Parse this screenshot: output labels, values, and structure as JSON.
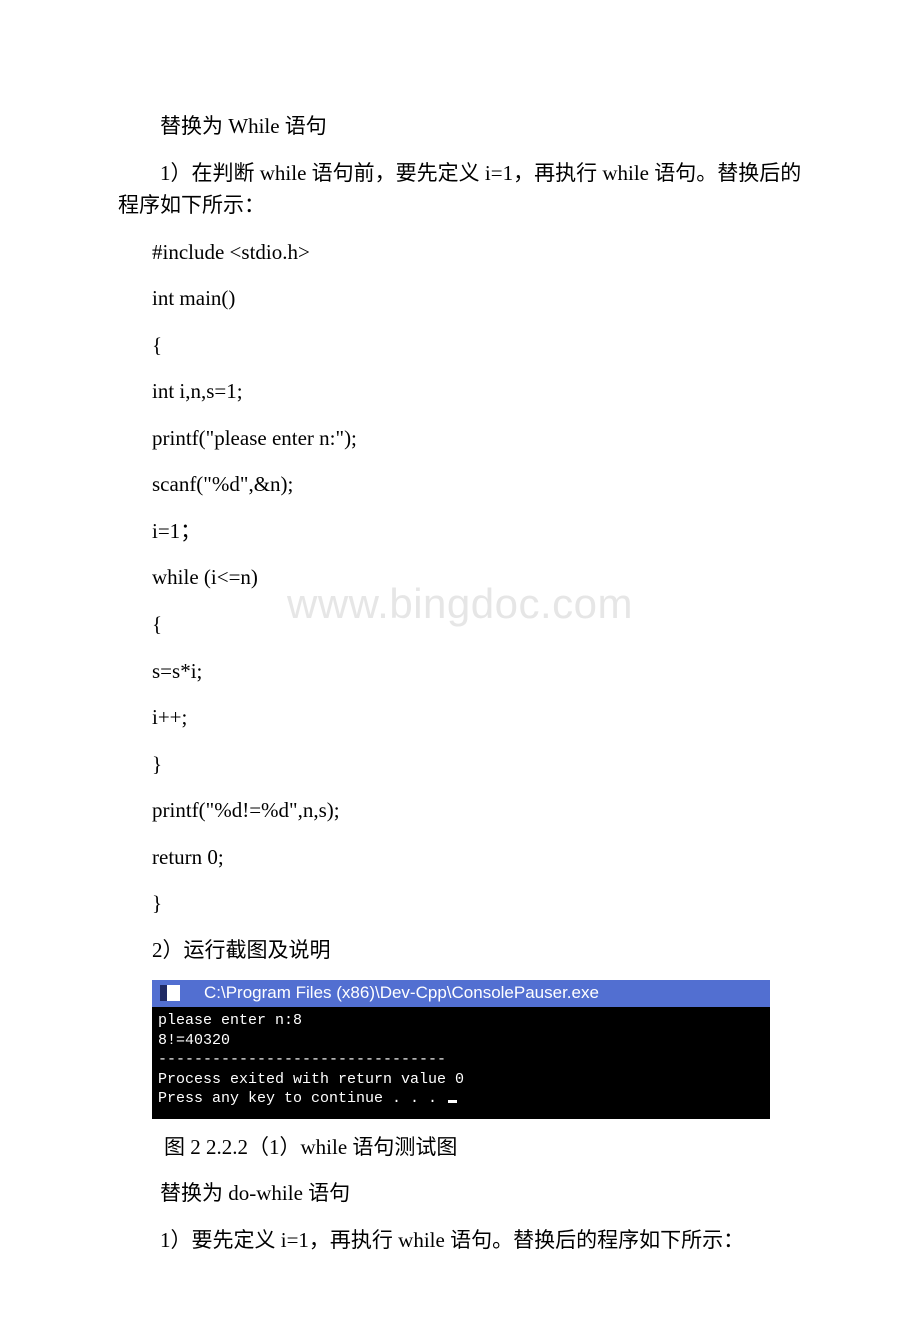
{
  "watermark": "www.bingdoc.com",
  "paragraphs": {
    "p1": "替换为 While 语句",
    "p2": "1）在判断 while 语句前，要先定义 i=1，再执行 while 语句。替换后的程序如下所示：",
    "p3": "2）运行截图及说明",
    "caption": "图 2  2.2.2（1）while 语句测试图",
    "p4": "替换为 do-while 语句",
    "p5": "1）要先定义 i=1，再执行 while 语句。替换后的程序如下所示："
  },
  "code": {
    "l1": "#include <stdio.h>",
    "l2": "int main()",
    "l3": "{",
    "l4": "int i,n,s=1;",
    "l5": " printf(\"please enter n:\");",
    "l6": " scanf(\"%d\",&n);",
    "l7": " i=1；",
    "l8": " while (i<=n)",
    "l9": " {",
    "l10": " s=s*i;",
    "l11": " i++;",
    "l12": " }",
    "l13": " printf(\"%d!=%d\",n,s);",
    "l14": " return 0;",
    "l15": " }"
  },
  "console": {
    "title": "C:\\Program Files (x86)\\Dev-Cpp\\ConsolePauser.exe",
    "line1": "please enter n:8",
    "line2": "8!=40320",
    "line3": "--------------------------------",
    "line4": "Process exited with return value 0",
    "line5": "Press any key to continue . . . "
  }
}
